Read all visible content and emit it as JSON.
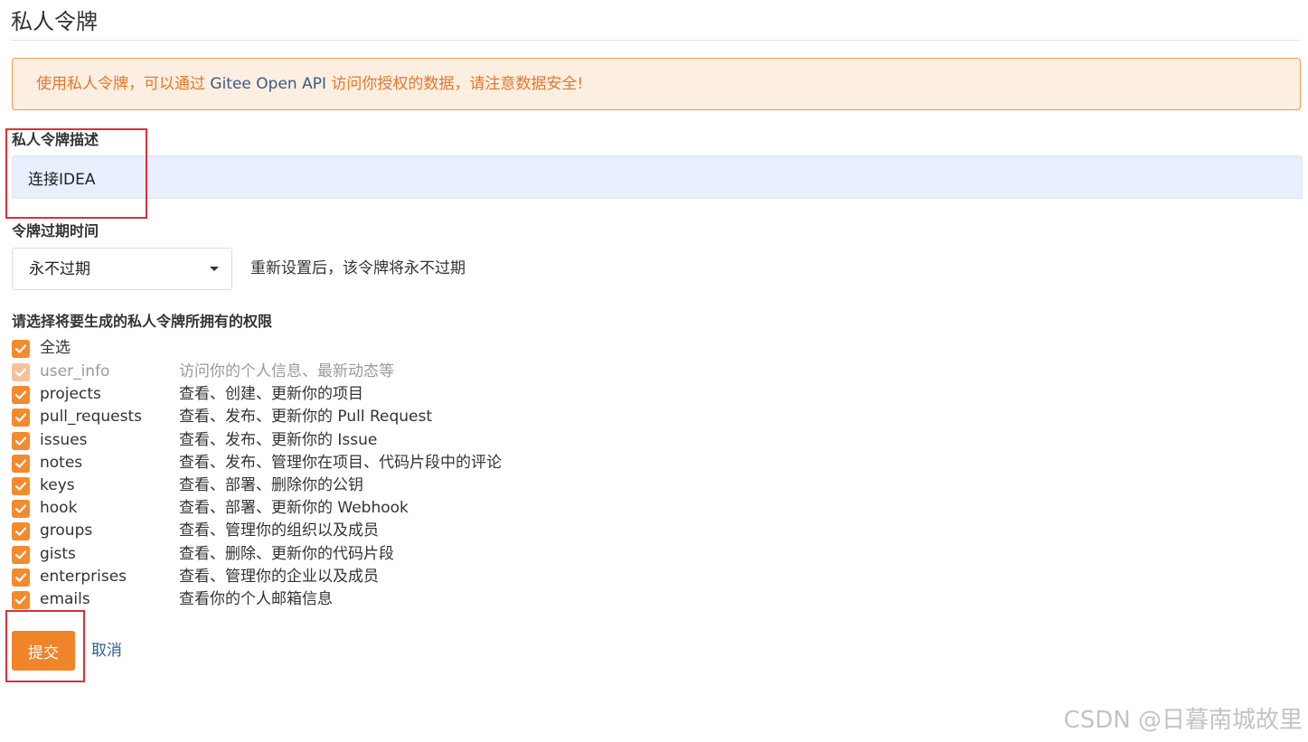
{
  "page_title": "私人令牌",
  "notice": {
    "prefix": "使用私人令牌，可以通过 ",
    "api": "Gitee Open API",
    "suffix": " 访问你授权的数据，请注意数据安全!"
  },
  "description": {
    "label": "私人令牌描述",
    "value": "连接IDEA"
  },
  "expiry": {
    "label": "令牌过期时间",
    "selected": "永不过期",
    "hint": "重新设置后，该令牌将永不过期"
  },
  "permissions": {
    "label": "请选择将要生成的私人令牌所拥有的权限",
    "select_all_label": "全选",
    "items": [
      {
        "name": "user_info",
        "desc": "访问你的个人信息、最新动态等",
        "checked": true,
        "disabled": true
      },
      {
        "name": "projects",
        "desc": "查看、创建、更新你的项目",
        "checked": true,
        "disabled": false
      },
      {
        "name": "pull_requests",
        "desc": "查看、发布、更新你的 Pull Request",
        "checked": true,
        "disabled": false
      },
      {
        "name": "issues",
        "desc": "查看、发布、更新你的 Issue",
        "checked": true,
        "disabled": false
      },
      {
        "name": "notes",
        "desc": "查看、发布、管理你在项目、代码片段中的评论",
        "checked": true,
        "disabled": false
      },
      {
        "name": "keys",
        "desc": "查看、部署、删除你的公钥",
        "checked": true,
        "disabled": false
      },
      {
        "name": "hook",
        "desc": "查看、部署、更新你的 Webhook",
        "checked": true,
        "disabled": false
      },
      {
        "name": "groups",
        "desc": "查看、管理你的组织以及成员",
        "checked": true,
        "disabled": false
      },
      {
        "name": "gists",
        "desc": "查看、删除、更新你的代码片段",
        "checked": true,
        "disabled": false
      },
      {
        "name": "enterprises",
        "desc": "查看、管理你的企业以及成员",
        "checked": true,
        "disabled": false
      },
      {
        "name": "emails",
        "desc": "查看你的个人邮箱信息",
        "checked": true,
        "disabled": false
      }
    ]
  },
  "actions": {
    "submit_label": "提交",
    "cancel_label": "取消"
  },
  "watermark": "CSDN @日暮南城故里",
  "colors": {
    "accent": "#f0842a",
    "notice_bg": "#fcefe1",
    "notice_border": "#ef9a4f",
    "highlight_box": "#d9303a",
    "input_bg": "#e8f0fe",
    "link": "#2d5f8b"
  }
}
